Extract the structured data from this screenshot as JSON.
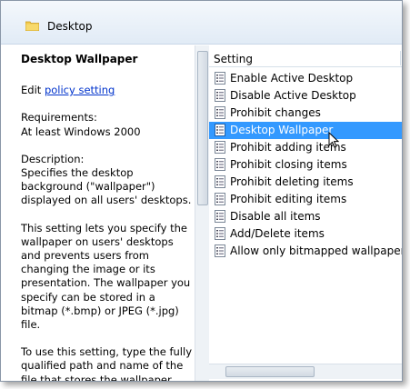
{
  "header": {
    "title": "Desktop"
  },
  "description": {
    "heading": "Desktop Wallpaper",
    "edit_prefix": "Edit",
    "edit_link": "policy setting",
    "requirements_label": "Requirements:",
    "requirements_value": "At least Windows 2000",
    "description_label": "Description:",
    "description_text": "Specifies the desktop background (\"wallpaper\") displayed on all users' desktops.",
    "paragraph2": "This setting lets you specify the wallpaper on users' desktops and prevents users from changing the image or its presentation. The wallpaper you specify can be stored in a bitmap (*.bmp) or JPEG (*.jpg) file.",
    "paragraph3": "To use this setting, type the fully qualified path and name of the file that stores the wallpaper image."
  },
  "list": {
    "column_header": "Setting",
    "items": [
      "Enable Active Desktop",
      "Disable Active Desktop",
      "Prohibit changes",
      "Desktop Wallpaper",
      "Prohibit adding items",
      "Prohibit closing items",
      "Prohibit deleting items",
      "Prohibit editing items",
      "Disable all items",
      "Add/Delete items",
      "Allow only bitmapped wallpaper"
    ],
    "selected_index": 3
  },
  "colors": {
    "selection": "#3399ff",
    "link": "#0033cc"
  }
}
